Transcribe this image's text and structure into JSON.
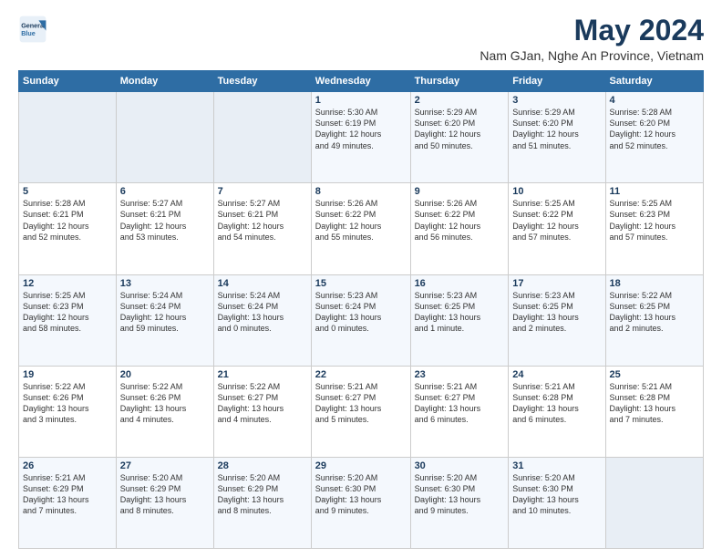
{
  "header": {
    "logo_line1": "General",
    "logo_line2": "Blue",
    "title": "May 2024",
    "subtitle": "Nam GJan, Nghe An Province, Vietnam"
  },
  "weekdays": [
    "Sunday",
    "Monday",
    "Tuesday",
    "Wednesday",
    "Thursday",
    "Friday",
    "Saturday"
  ],
  "weeks": [
    [
      {
        "day": "",
        "info": ""
      },
      {
        "day": "",
        "info": ""
      },
      {
        "day": "",
        "info": ""
      },
      {
        "day": "1",
        "info": "Sunrise: 5:30 AM\nSunset: 6:19 PM\nDaylight: 12 hours\nand 49 minutes."
      },
      {
        "day": "2",
        "info": "Sunrise: 5:29 AM\nSunset: 6:20 PM\nDaylight: 12 hours\nand 50 minutes."
      },
      {
        "day": "3",
        "info": "Sunrise: 5:29 AM\nSunset: 6:20 PM\nDaylight: 12 hours\nand 51 minutes."
      },
      {
        "day": "4",
        "info": "Sunrise: 5:28 AM\nSunset: 6:20 PM\nDaylight: 12 hours\nand 52 minutes."
      }
    ],
    [
      {
        "day": "5",
        "info": "Sunrise: 5:28 AM\nSunset: 6:21 PM\nDaylight: 12 hours\nand 52 minutes."
      },
      {
        "day": "6",
        "info": "Sunrise: 5:27 AM\nSunset: 6:21 PM\nDaylight: 12 hours\nand 53 minutes."
      },
      {
        "day": "7",
        "info": "Sunrise: 5:27 AM\nSunset: 6:21 PM\nDaylight: 12 hours\nand 54 minutes."
      },
      {
        "day": "8",
        "info": "Sunrise: 5:26 AM\nSunset: 6:22 PM\nDaylight: 12 hours\nand 55 minutes."
      },
      {
        "day": "9",
        "info": "Sunrise: 5:26 AM\nSunset: 6:22 PM\nDaylight: 12 hours\nand 56 minutes."
      },
      {
        "day": "10",
        "info": "Sunrise: 5:25 AM\nSunset: 6:22 PM\nDaylight: 12 hours\nand 57 minutes."
      },
      {
        "day": "11",
        "info": "Sunrise: 5:25 AM\nSunset: 6:23 PM\nDaylight: 12 hours\nand 57 minutes."
      }
    ],
    [
      {
        "day": "12",
        "info": "Sunrise: 5:25 AM\nSunset: 6:23 PM\nDaylight: 12 hours\nand 58 minutes."
      },
      {
        "day": "13",
        "info": "Sunrise: 5:24 AM\nSunset: 6:24 PM\nDaylight: 12 hours\nand 59 minutes."
      },
      {
        "day": "14",
        "info": "Sunrise: 5:24 AM\nSunset: 6:24 PM\nDaylight: 13 hours\nand 0 minutes."
      },
      {
        "day": "15",
        "info": "Sunrise: 5:23 AM\nSunset: 6:24 PM\nDaylight: 13 hours\nand 0 minutes."
      },
      {
        "day": "16",
        "info": "Sunrise: 5:23 AM\nSunset: 6:25 PM\nDaylight: 13 hours\nand 1 minute."
      },
      {
        "day": "17",
        "info": "Sunrise: 5:23 AM\nSunset: 6:25 PM\nDaylight: 13 hours\nand 2 minutes."
      },
      {
        "day": "18",
        "info": "Sunrise: 5:22 AM\nSunset: 6:25 PM\nDaylight: 13 hours\nand 2 minutes."
      }
    ],
    [
      {
        "day": "19",
        "info": "Sunrise: 5:22 AM\nSunset: 6:26 PM\nDaylight: 13 hours\nand 3 minutes."
      },
      {
        "day": "20",
        "info": "Sunrise: 5:22 AM\nSunset: 6:26 PM\nDaylight: 13 hours\nand 4 minutes."
      },
      {
        "day": "21",
        "info": "Sunrise: 5:22 AM\nSunset: 6:27 PM\nDaylight: 13 hours\nand 4 minutes."
      },
      {
        "day": "22",
        "info": "Sunrise: 5:21 AM\nSunset: 6:27 PM\nDaylight: 13 hours\nand 5 minutes."
      },
      {
        "day": "23",
        "info": "Sunrise: 5:21 AM\nSunset: 6:27 PM\nDaylight: 13 hours\nand 6 minutes."
      },
      {
        "day": "24",
        "info": "Sunrise: 5:21 AM\nSunset: 6:28 PM\nDaylight: 13 hours\nand 6 minutes."
      },
      {
        "day": "25",
        "info": "Sunrise: 5:21 AM\nSunset: 6:28 PM\nDaylight: 13 hours\nand 7 minutes."
      }
    ],
    [
      {
        "day": "26",
        "info": "Sunrise: 5:21 AM\nSunset: 6:29 PM\nDaylight: 13 hours\nand 7 minutes."
      },
      {
        "day": "27",
        "info": "Sunrise: 5:20 AM\nSunset: 6:29 PM\nDaylight: 13 hours\nand 8 minutes."
      },
      {
        "day": "28",
        "info": "Sunrise: 5:20 AM\nSunset: 6:29 PM\nDaylight: 13 hours\nand 8 minutes."
      },
      {
        "day": "29",
        "info": "Sunrise: 5:20 AM\nSunset: 6:30 PM\nDaylight: 13 hours\nand 9 minutes."
      },
      {
        "day": "30",
        "info": "Sunrise: 5:20 AM\nSunset: 6:30 PM\nDaylight: 13 hours\nand 9 minutes."
      },
      {
        "day": "31",
        "info": "Sunrise: 5:20 AM\nSunset: 6:30 PM\nDaylight: 13 hours\nand 10 minutes."
      },
      {
        "day": "",
        "info": ""
      }
    ]
  ]
}
